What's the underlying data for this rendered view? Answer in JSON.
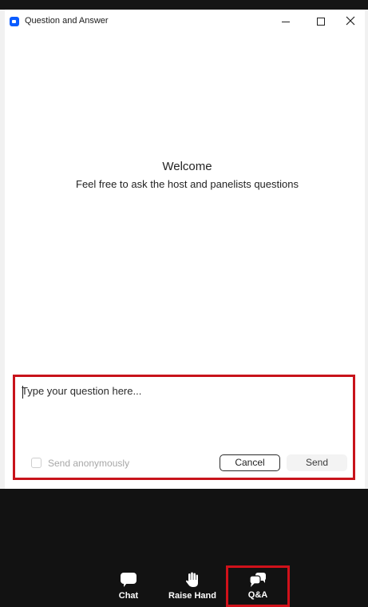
{
  "window": {
    "title": "Question and Answer",
    "controls": {
      "minimize_icon": "minimize-icon",
      "maximize_icon": "maximize-icon",
      "close_icon": "close-icon"
    }
  },
  "content": {
    "welcome": "Welcome",
    "subtitle": "Feel free to ask the host and panelists questions"
  },
  "composer": {
    "placeholder": "Type your question here...",
    "anonymous_label": "Send anonymously",
    "anonymous_checked": false,
    "cancel_label": "Cancel",
    "send_label": "Send",
    "highlight_color": "#c8131b"
  },
  "toolbar": {
    "items": [
      {
        "label": "Chat",
        "icon": "chat-bubble-icon"
      },
      {
        "label": "Raise Hand",
        "icon": "raise-hand-icon"
      },
      {
        "label": "Q&A",
        "icon": "qa-bubbles-icon",
        "highlighted": true
      }
    ],
    "background": "#121212"
  },
  "colors": {
    "app_icon": "#0b5cff",
    "highlight": "#d0111a"
  }
}
